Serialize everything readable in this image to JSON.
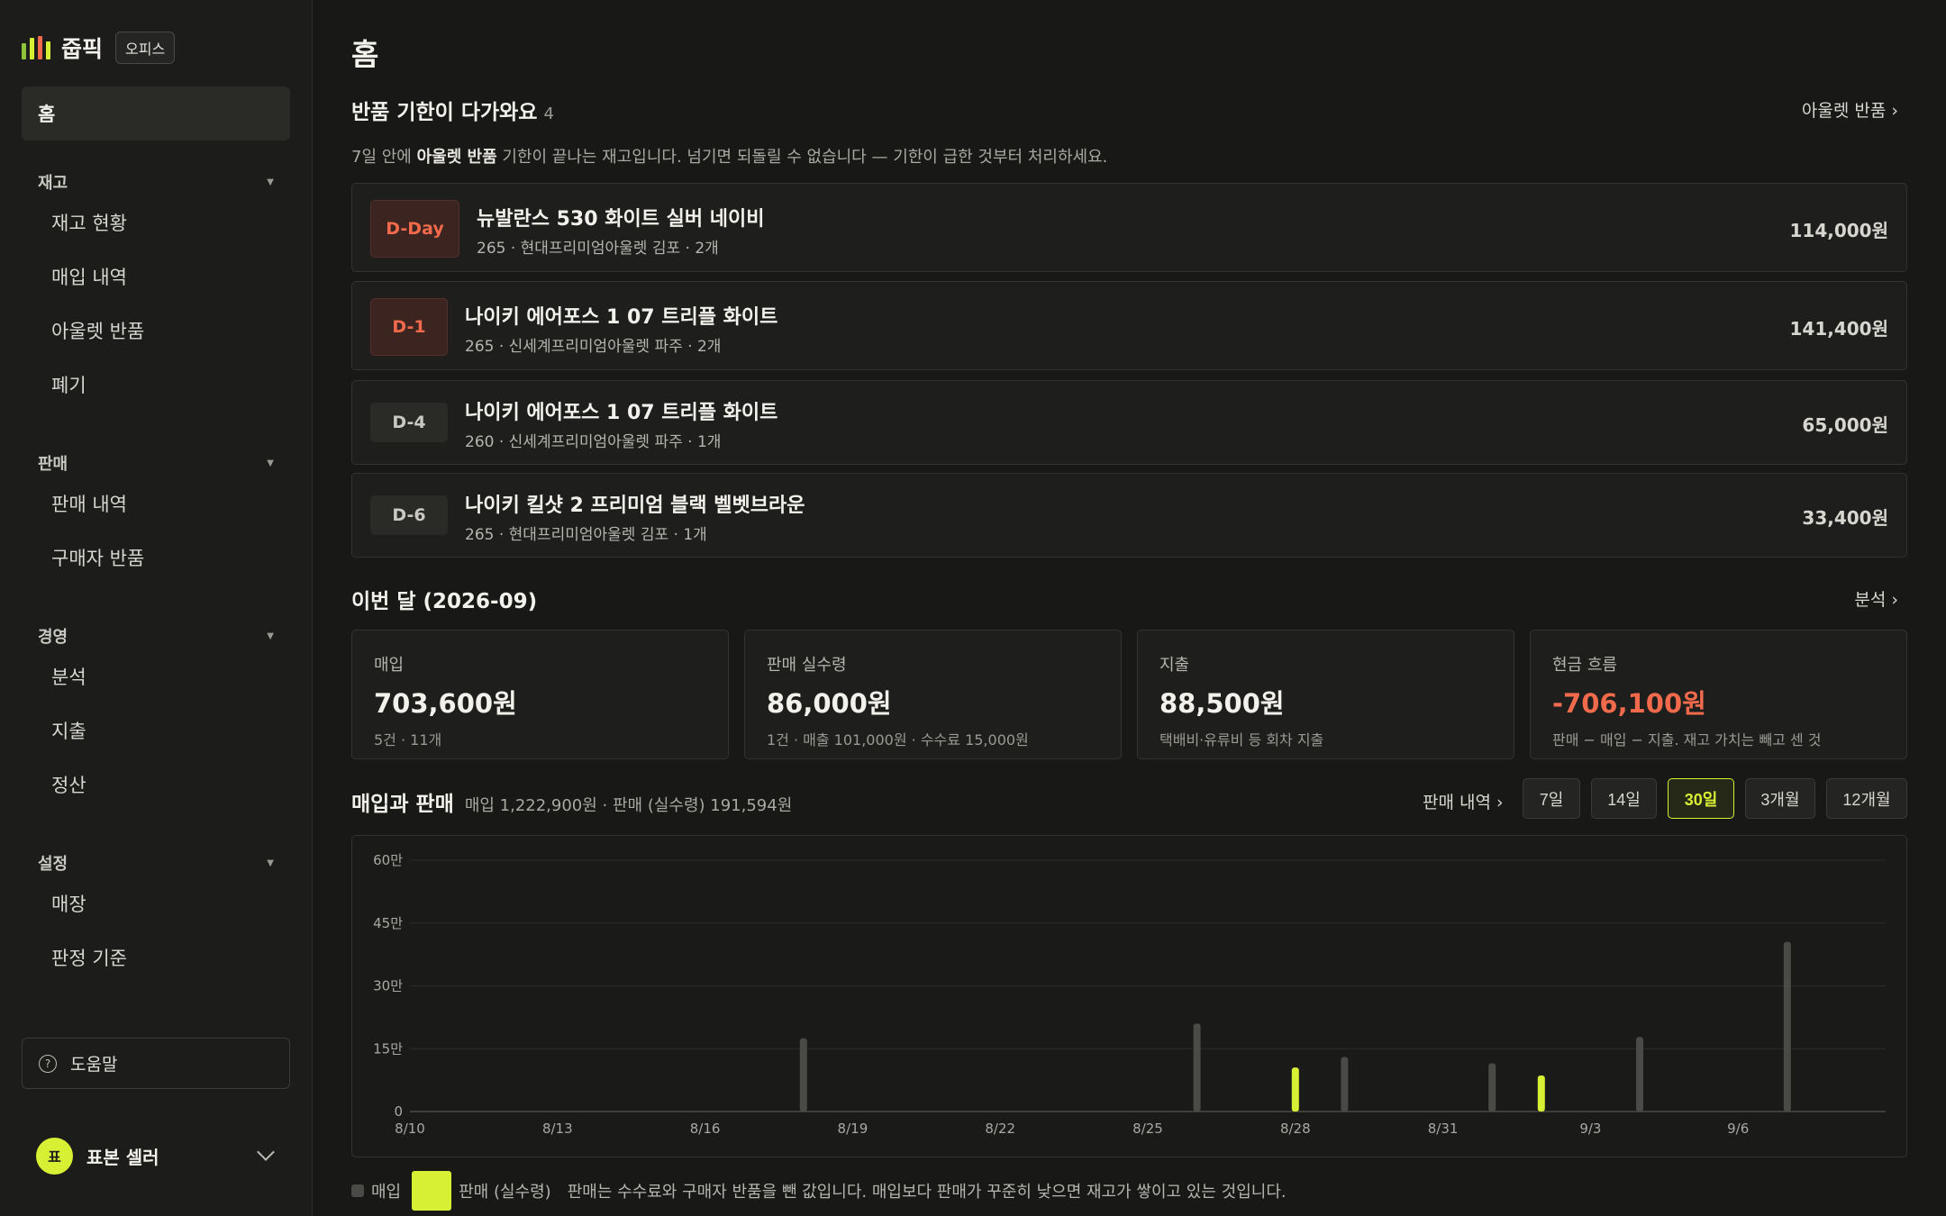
{
  "brand": {
    "name": "줍픽",
    "badge": "오피스",
    "logo_colors": [
      "#8fc43a",
      "#d8f034",
      "#f26a4c",
      "#d8f034"
    ]
  },
  "sidebar": {
    "home": "홈",
    "sections": [
      {
        "label": "재고",
        "items": [
          "재고 현황",
          "매입 내역",
          "아울렛 반품",
          "폐기"
        ]
      },
      {
        "label": "판매",
        "items": [
          "판매 내역",
          "구매자 반품"
        ]
      },
      {
        "label": "경영",
        "items": [
          "분석",
          "지출",
          "정산"
        ]
      },
      {
        "label": "설정",
        "items": [
          "매장",
          "판정 기준"
        ]
      }
    ],
    "help": "도움말",
    "user": {
      "initial": "표",
      "name": "표본 셀러"
    }
  },
  "page_title": "홈",
  "returns": {
    "title": "반품 기한이 다가와요",
    "count": "4",
    "link": "아울렛 반품 ›",
    "desc_pre": "7일 안에 ",
    "desc_bold": "아울렛 반품",
    "desc_post": " 기한이 끝나는 재고입니다. 넘기면 되돌릴 수 없습니다 — 기한이 급한 것부터 처리하세요.",
    "items": [
      {
        "badge": "D-Day",
        "urgent": true,
        "name": "뉴발란스 530 화이트 실버 네이비",
        "sub": "265 · 현대프리미엄아울렛 김포 · 2개",
        "price": "114,000원"
      },
      {
        "badge": "D-1",
        "urgent": true,
        "name": "나이키 에어포스 1 07 트리플 화이트",
        "sub": "265 · 신세계프리미엄아울렛 파주 · 2개",
        "price": "141,400원"
      },
      {
        "badge": "D-4",
        "urgent": false,
        "name": "나이키 에어포스 1 07 트리플 화이트",
        "sub": "260 · 신세계프리미엄아울렛 파주 · 1개",
        "price": "65,000원"
      },
      {
        "badge": "D-6",
        "urgent": false,
        "name": "나이키 킬샷 2 프리미엄 블랙 벨벳브라운",
        "sub": "265 · 현대프리미엄아울렛 김포 · 1개",
        "price": "33,400원"
      }
    ]
  },
  "month": {
    "title": "이번 달 (2026-09)",
    "link": "분석 ›",
    "stats": [
      {
        "label": "매입",
        "value": "703,600원",
        "sub": "5건 · 11개",
        "negative": false
      },
      {
        "label": "판매 실수령",
        "value": "86,000원",
        "sub": "1건 · 매출 101,000원 · 수수료 15,000원",
        "negative": false
      },
      {
        "label": "지출",
        "value": "88,500원",
        "sub": "택배비·유류비 등 회차 지출",
        "negative": false
      },
      {
        "label": "현금 흐름",
        "value": "-706,100원",
        "sub": "판매 − 매입 − 지출. 재고 가치는 빼고 센 것",
        "negative": true
      }
    ]
  },
  "chart_section": {
    "title": "매입과 판매",
    "summary": "매입 1,222,900원 · 판매 (실수령) 191,594원",
    "link": "판매 내역 ›",
    "ranges": [
      "7일",
      "14일",
      "30일",
      "3개월",
      "12개월"
    ],
    "active_range": "30일",
    "legend": {
      "purchase": "매입",
      "sales": "판매 (실수령)",
      "note": "판매는 수수료와 구매자 반품을 뺀 값입니다. 매입보다 판매가 꾸준히 낮으면 재고가 쌓이고 있는 것입니다."
    }
  },
  "chart_data": {
    "type": "bar",
    "x_labels": [
      "8/10",
      "8/13",
      "8/16",
      "8/19",
      "8/22",
      "8/25",
      "8/28",
      "8/31",
      "9/3",
      "9/6"
    ],
    "y_ticks": [
      "0",
      "15만",
      "30만",
      "45만",
      "60만"
    ],
    "ylim": [
      0,
      600000
    ],
    "grid": true,
    "legend_position": "bottom-left",
    "x_start": "2026-08-10",
    "x_end": "2026-09-09",
    "colors": {
      "purchase": "#4a4a46",
      "sales": "#d8f034"
    },
    "series": [
      {
        "name": "매입",
        "points": [
          {
            "date": "2026-08-18",
            "value": 175000
          },
          {
            "date": "2026-08-26",
            "value": 210000
          },
          {
            "date": "2026-08-29",
            "value": 130000
          },
          {
            "date": "2026-09-01",
            "value": 115000
          },
          {
            "date": "2026-09-04",
            "value": 178000
          },
          {
            "date": "2026-09-07",
            "value": 405000
          }
        ]
      },
      {
        "name": "판매 (실수령)",
        "points": [
          {
            "date": "2026-08-28",
            "value": 105000
          },
          {
            "date": "2026-09-02",
            "value": 86000
          }
        ]
      }
    ]
  }
}
